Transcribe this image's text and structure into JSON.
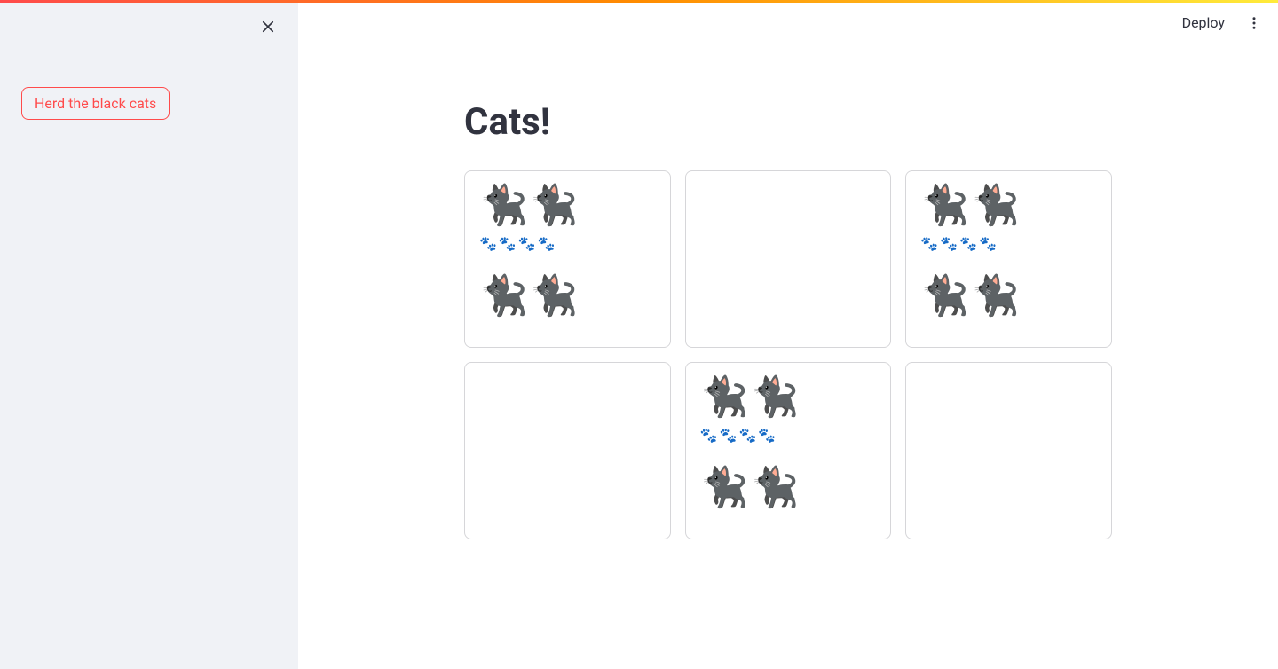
{
  "sidebar": {
    "herd_button_label": "Herd the black cats"
  },
  "header": {
    "deploy_label": "Deploy"
  },
  "main": {
    "title": "Cats!",
    "cells": [
      {
        "filled": true,
        "cats_top": "🐈‍⬛🐈‍⬛",
        "paws": "🐾🐾🐾🐾",
        "cats_bottom": "🐈‍⬛🐈‍⬛"
      },
      {
        "filled": false,
        "cats_top": "",
        "paws": "",
        "cats_bottom": ""
      },
      {
        "filled": true,
        "cats_top": "🐈‍⬛🐈‍⬛",
        "paws": "🐾🐾🐾🐾",
        "cats_bottom": "🐈‍⬛🐈‍⬛"
      },
      {
        "filled": false,
        "cats_top": "",
        "paws": "",
        "cats_bottom": ""
      },
      {
        "filled": true,
        "cats_top": "🐈‍⬛🐈‍⬛",
        "paws": "🐾🐾🐾🐾",
        "cats_bottom": "🐈‍⬛🐈‍⬛"
      },
      {
        "filled": false,
        "cats_top": "",
        "paws": "",
        "cats_bottom": ""
      }
    ]
  }
}
